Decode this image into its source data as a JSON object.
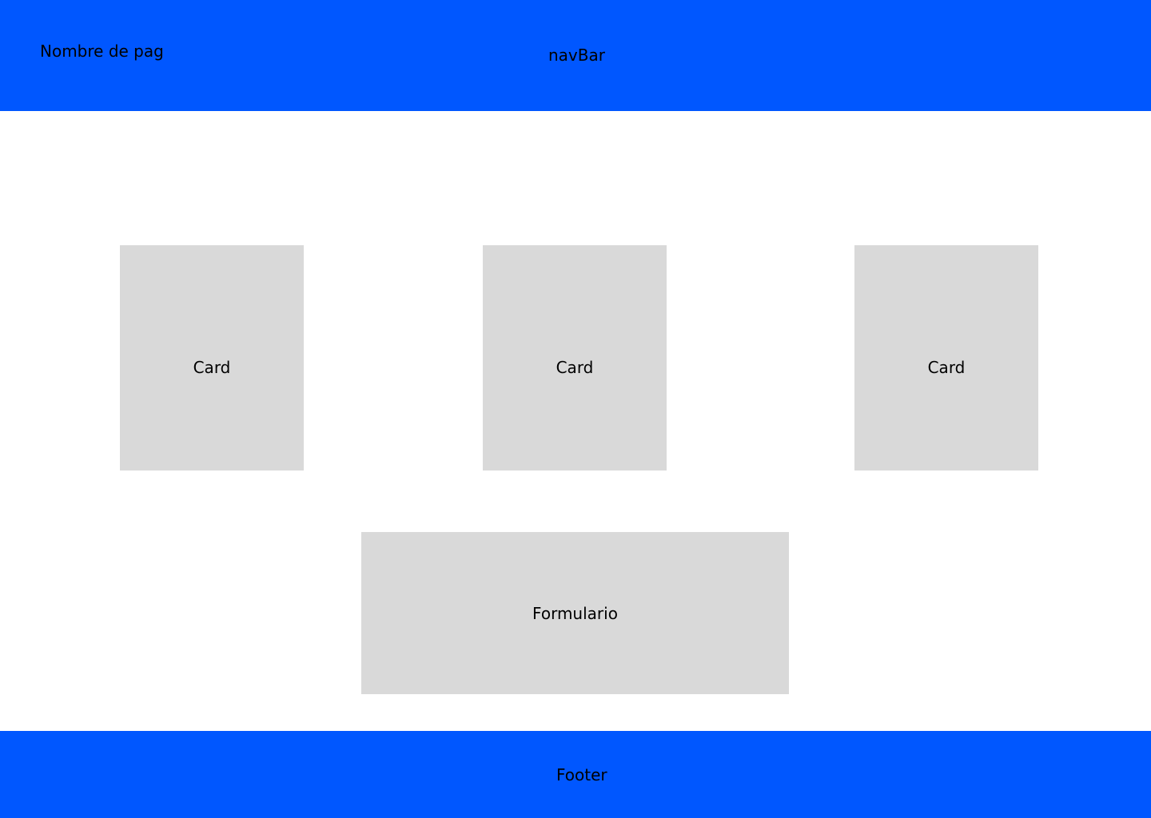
{
  "header": {
    "site_name": "Nombre de pag",
    "nav_label": "navBar",
    "background_color": "#0057ff"
  },
  "cards": [
    {
      "label": "Card"
    },
    {
      "label": "Card"
    },
    {
      "label": "Card"
    }
  ],
  "form": {
    "label": "Formulario"
  },
  "footer": {
    "label": "Footer",
    "background_color": "#0057ff"
  },
  "placeholder_color": "#d9d9d9"
}
